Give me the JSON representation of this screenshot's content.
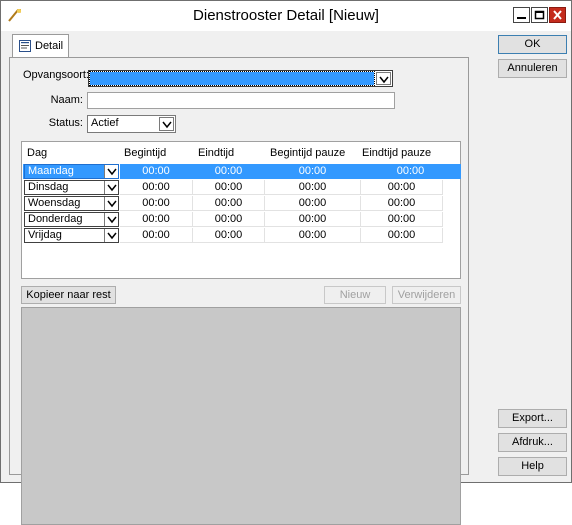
{
  "window": {
    "title": "Dienstrooster Detail [Nieuw]",
    "controls": {
      "minimize": "minimize-icon",
      "maximize": "maximize-icon",
      "close": "close-icon"
    }
  },
  "tabs": [
    {
      "label": "Detail",
      "icon": "document-icon",
      "active": true
    }
  ],
  "form": {
    "opvangsoort_label": "Opvangsoort:",
    "opvangsoort_value": "",
    "naam_label": "Naam:",
    "naam_value": "",
    "status_label": "Status:",
    "status_value": "Actief"
  },
  "grid": {
    "headers": [
      "Dag",
      "Begintijd",
      "Eindtijd",
      "Begintijd pauze",
      "Eindtijd pauze"
    ],
    "rows": [
      {
        "dag": "Maandag",
        "begintijd": "00:00",
        "eindtijd": "00:00",
        "begintijd_pauze": "00:00",
        "eindtijd_pauze": "00:00",
        "selected": true
      },
      {
        "dag": "Dinsdag",
        "begintijd": "00:00",
        "eindtijd": "00:00",
        "begintijd_pauze": "00:00",
        "eindtijd_pauze": "00:00"
      },
      {
        "dag": "Woensdag",
        "begintijd": "00:00",
        "eindtijd": "00:00",
        "begintijd_pauze": "00:00",
        "eindtijd_pauze": "00:00"
      },
      {
        "dag": "Donderdag",
        "begintijd": "00:00",
        "eindtijd": "00:00",
        "begintijd_pauze": "00:00",
        "eindtijd_pauze": "00:00"
      },
      {
        "dag": "Vrijdag",
        "begintijd": "00:00",
        "eindtijd": "00:00",
        "begintijd_pauze": "00:00",
        "eindtijd_pauze": "00:00"
      }
    ]
  },
  "buttons": {
    "kopieer": "Kopieer naar rest",
    "nieuw": "Nieuw",
    "verwijderen": "Verwijderen",
    "ok": "OK",
    "annuleren": "Annuleren",
    "export": "Export...",
    "afdruk": "Afdruk...",
    "help": "Help"
  },
  "colors": {
    "selection": "#3399ff",
    "close_button": "#c42b1c"
  }
}
